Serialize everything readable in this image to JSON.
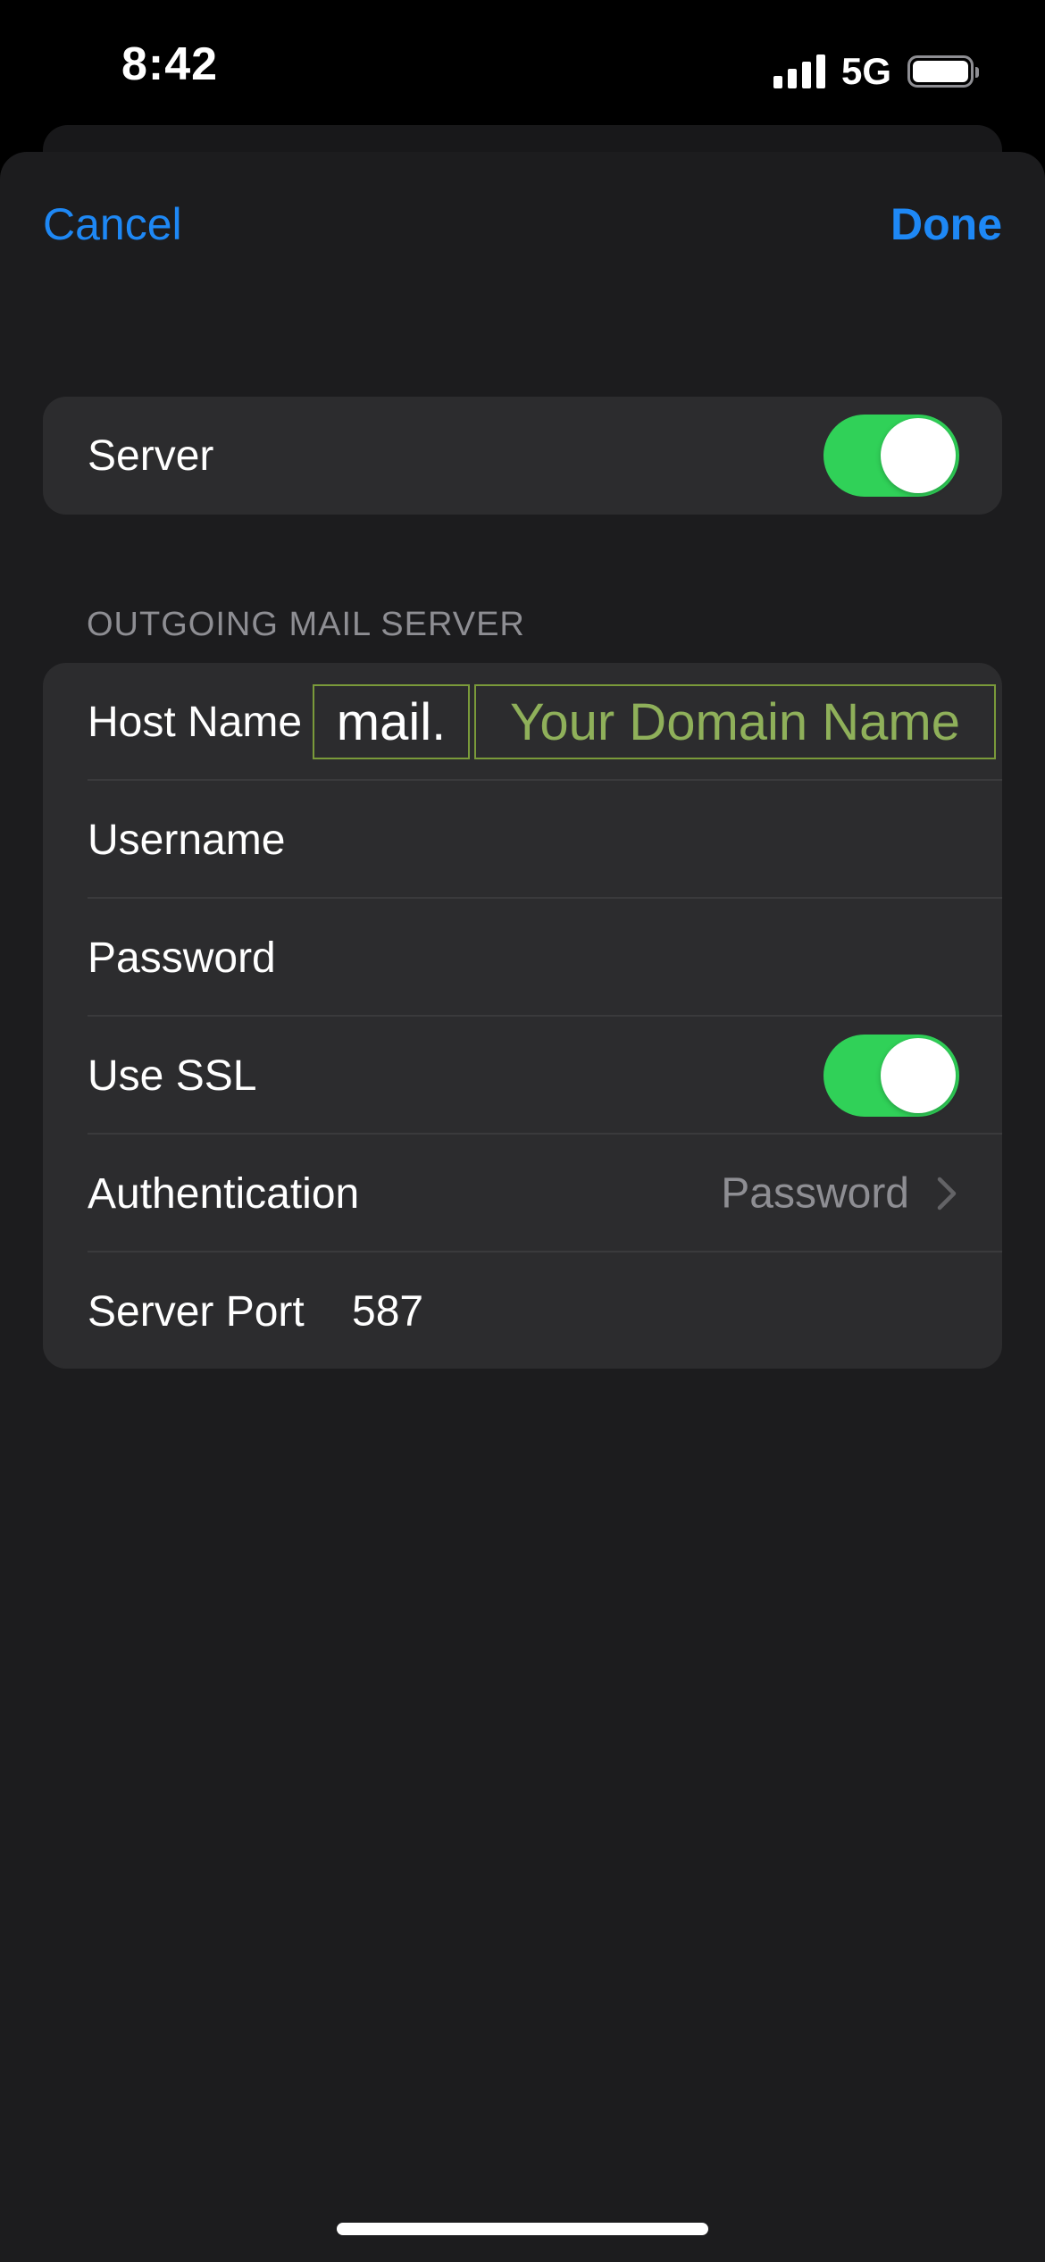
{
  "status_bar": {
    "time": "8:42",
    "network": "5G",
    "icons": [
      "signal-icon",
      "battery-icon"
    ]
  },
  "nav": {
    "cancel_label": "Cancel",
    "done_label": "Done"
  },
  "server_row": {
    "label": "Server",
    "enabled": true
  },
  "section": {
    "header": "OUTGOING MAIL SERVER"
  },
  "fields": {
    "host_name": {
      "label": "Host Name",
      "prefix": "mail.",
      "domain_placeholder": "Your Domain Name"
    },
    "username": {
      "label": "Username",
      "value": ""
    },
    "password": {
      "label": "Password",
      "value": ""
    },
    "use_ssl": {
      "label": "Use SSL",
      "enabled": true
    },
    "authentication": {
      "label": "Authentication",
      "value": "Password"
    },
    "server_port": {
      "label": "Server Port",
      "value": "587"
    }
  },
  "colors": {
    "accent": "#1e88f5",
    "toggle_on": "#30d158",
    "sheet_bg": "#1c1c1e",
    "group_bg": "#2c2c2e",
    "annotation": "#8fb05a"
  }
}
